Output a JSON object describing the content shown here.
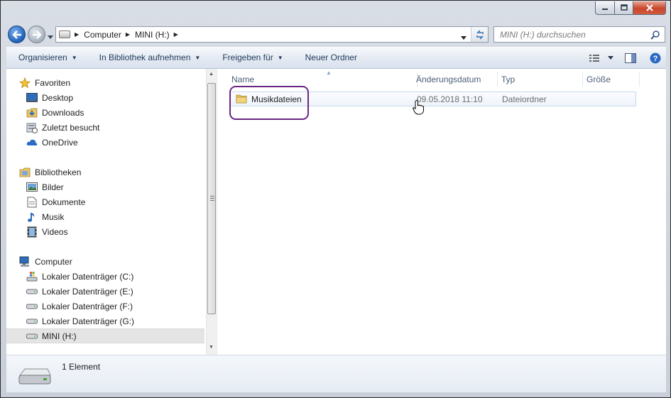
{
  "window": {
    "caption_buttons": [
      "minimize",
      "maximize",
      "close"
    ]
  },
  "address": {
    "segments": [
      "Computer",
      "MINI (H:)"
    ]
  },
  "search": {
    "placeholder": "MINI (H:) durchsuchen"
  },
  "toolbar": {
    "organize_label": "Organisieren",
    "include_library_label": "In Bibliothek aufnehmen",
    "share_label": "Freigeben für",
    "new_folder_label": "Neuer Ordner"
  },
  "nav": {
    "favorites": {
      "label": "Favoriten",
      "items": [
        {
          "label": "Desktop",
          "icon": "desktop-icon"
        },
        {
          "label": "Downloads",
          "icon": "downloads-folder-icon"
        },
        {
          "label": "Zuletzt besucht",
          "icon": "recent-places-icon"
        },
        {
          "label": "OneDrive",
          "icon": "onedrive-icon"
        }
      ]
    },
    "libraries": {
      "label": "Bibliotheken",
      "items": [
        {
          "label": "Bilder",
          "icon": "pictures-icon"
        },
        {
          "label": "Dokumente",
          "icon": "documents-icon"
        },
        {
          "label": "Musik",
          "icon": "music-note-icon"
        },
        {
          "label": "Videos",
          "icon": "videos-icon"
        }
      ]
    },
    "computer": {
      "label": "Computer",
      "items": [
        {
          "label": "Lokaler Datenträger (C:)",
          "icon": "system-drive-icon"
        },
        {
          "label": "Lokaler Datenträger (E:)",
          "icon": "drive-icon"
        },
        {
          "label": "Lokaler Datenträger (F:)",
          "icon": "drive-icon"
        },
        {
          "label": "Lokaler Datenträger (G:)",
          "icon": "drive-icon"
        },
        {
          "label": "MINI (H:)",
          "icon": "drive-icon",
          "selected": true
        }
      ]
    }
  },
  "columns": {
    "name": "Name",
    "modified": "Änderungsdatum",
    "type": "Typ",
    "size": "Größe"
  },
  "files": [
    {
      "name": "Musikdateien",
      "modified": "09.05.2018 11:10",
      "type": "Dateiordner",
      "size": ""
    }
  ],
  "details": {
    "count": "1 Element"
  },
  "colors": {
    "highlight_border": "#6a2485",
    "toolbar_text": "#1e395b",
    "row_border": "#c5d7ea"
  }
}
